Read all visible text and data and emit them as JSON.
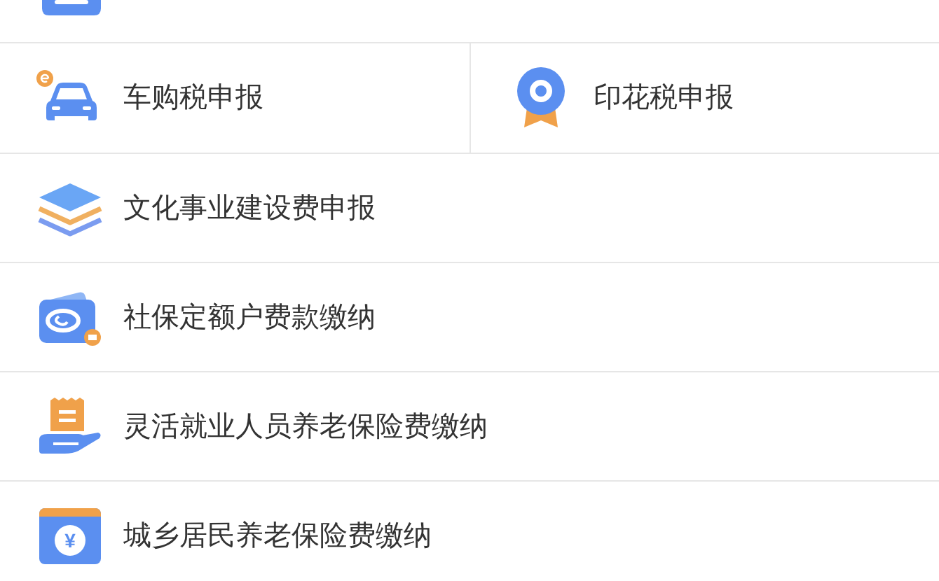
{
  "service_grid": [
    {
      "label": "车购税申报"
    },
    {
      "label": "印花税申报"
    }
  ],
  "service_list": [
    {
      "label": "文化事业建设费申报"
    },
    {
      "label": "社保定额户费款缴纳"
    },
    {
      "label": "灵活就业人员养老保险费缴纳"
    },
    {
      "label": "城乡居民养老保险费缴纳",
      "icon_symbol": "¥"
    }
  ]
}
